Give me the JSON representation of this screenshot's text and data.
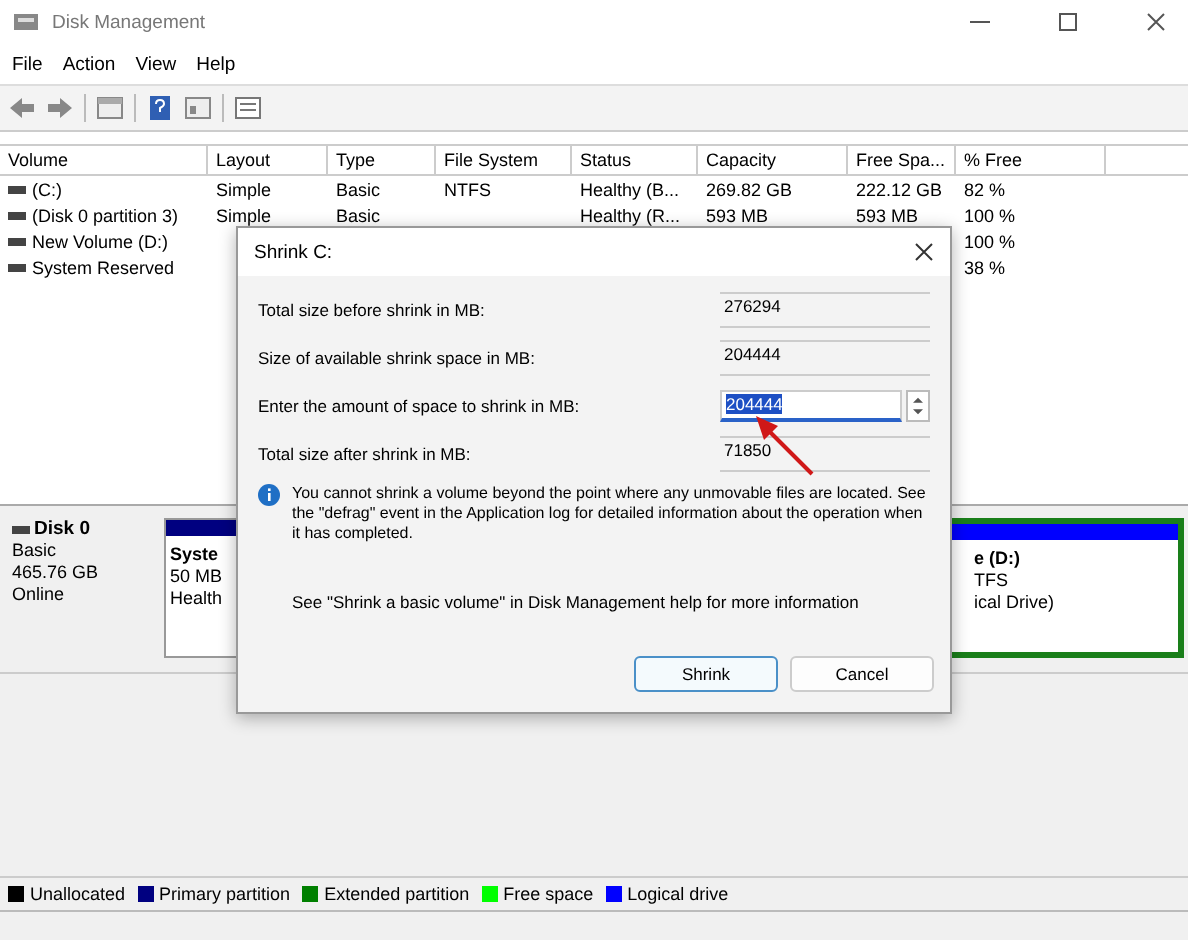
{
  "window": {
    "title": "Disk Management"
  },
  "menu": [
    "File",
    "Action",
    "View",
    "Help"
  ],
  "table": {
    "columns": [
      "Volume",
      "Layout",
      "Type",
      "File System",
      "Status",
      "Capacity",
      "Free Spa...",
      "% Free"
    ],
    "rows": [
      [
        "(C:)",
        "Simple",
        "Basic",
        "NTFS",
        "Healthy (B...",
        "269.82 GB",
        "222.12 GB",
        "82 %"
      ],
      [
        "(Disk 0 partition 3)",
        "Simple",
        "Basic",
        null,
        "Healthy (R...",
        "593 MB",
        "593 MB",
        "100 %"
      ],
      [
        "New Volume (D:)",
        null,
        null,
        null,
        null,
        null,
        null,
        "100 %"
      ],
      [
        "System Reserved",
        null,
        null,
        null,
        null,
        null,
        null,
        "38 %"
      ]
    ]
  },
  "disk": {
    "name": "Disk 0",
    "lines": [
      "Basic",
      "465.76 GB",
      "Online"
    ],
    "partitions": [
      {
        "lines": [
          "Syste",
          "50 MB",
          "Health"
        ],
        "color": "#000080"
      },
      {
        "lines": [
          "e  (D:)",
          "TFS",
          "ical Drive)"
        ],
        "color": "#0000ff"
      }
    ]
  },
  "legend": [
    {
      "label": "Unallocated",
      "color": "#000000"
    },
    {
      "label": "Primary partition",
      "color": "#000080"
    },
    {
      "label": "Extended partition",
      "color": "#008000"
    },
    {
      "label": "Free space",
      "color": "#00ff00"
    },
    {
      "label": "Logical drive",
      "color": "#0000ff"
    }
  ],
  "dialog": {
    "title": "Shrink C:",
    "fields": [
      {
        "kind": "readonly",
        "label": "Total size before shrink in MB:",
        "value": "276294"
      },
      {
        "kind": "readonly",
        "label": "Size of available shrink space in MB:",
        "value": "204444"
      },
      {
        "kind": "spin",
        "label": "Enter the amount of space to shrink in MB:",
        "value": "204444"
      },
      {
        "kind": "readonly",
        "label": "Total size after shrink in MB:",
        "value": "71850"
      }
    ],
    "info": "You cannot shrink a volume beyond the point where any unmovable files are located. See the \"defrag\" event in the Application log for detailed information about the operation when it has completed.",
    "help": "See \"Shrink a basic volume\" in Disk Management help for more information",
    "buttons": [
      {
        "label": "Shrink",
        "default": true
      },
      {
        "label": "Cancel",
        "default": false
      }
    ]
  }
}
